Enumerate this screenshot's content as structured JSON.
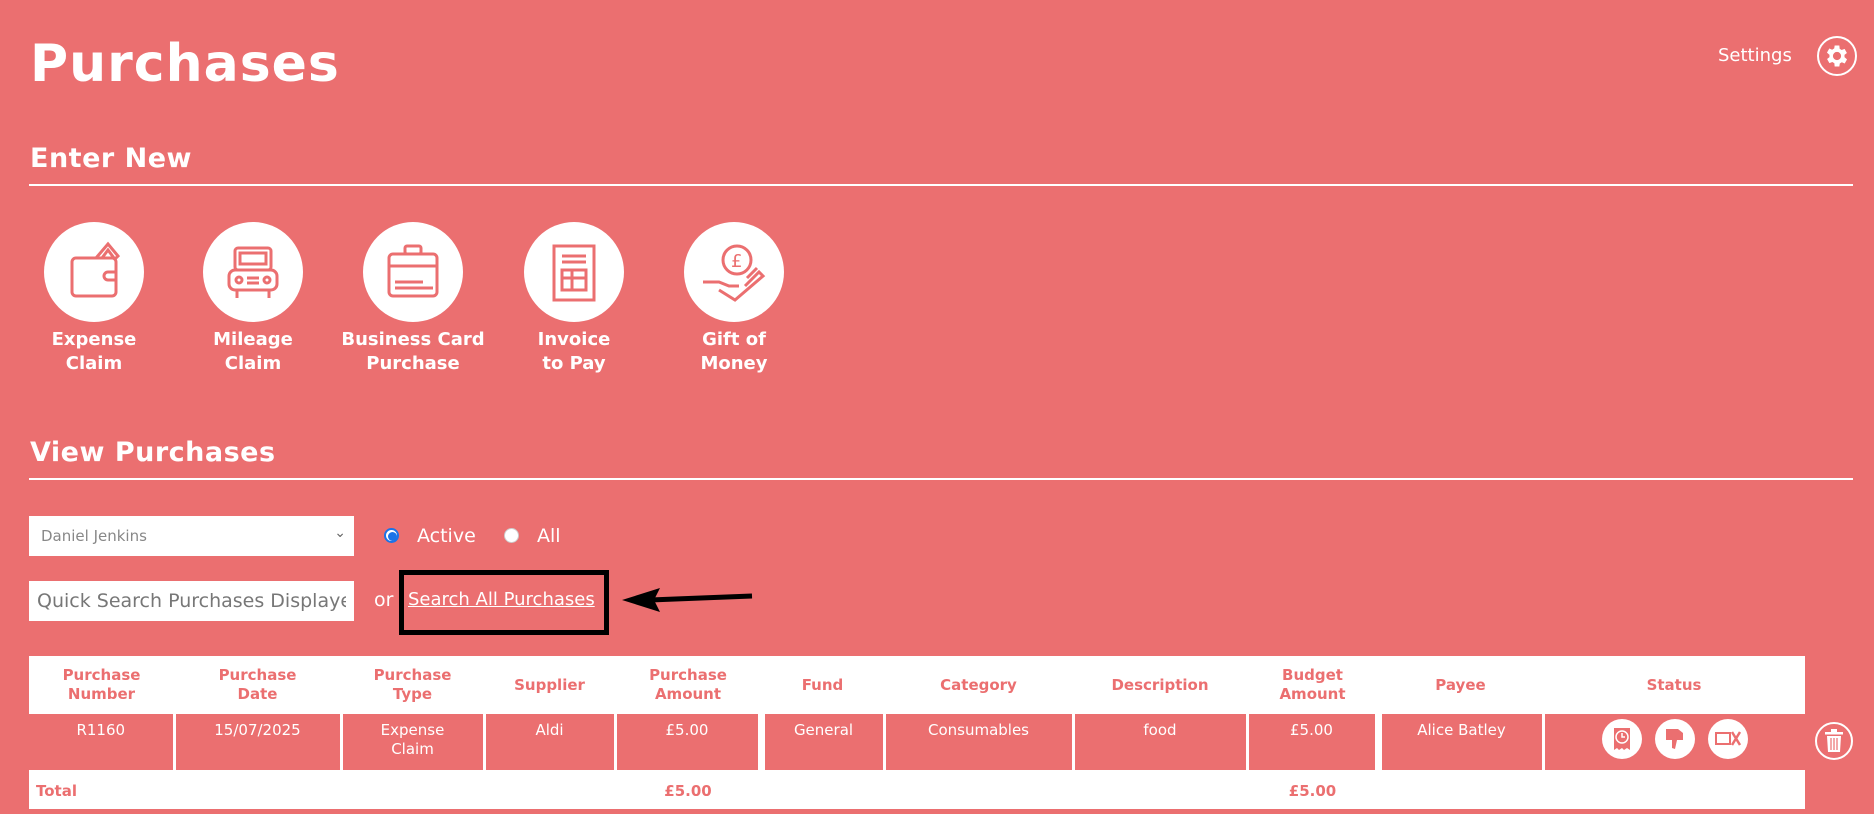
{
  "header": {
    "title": "Purchases",
    "settings_label": "Settings"
  },
  "enter_new": {
    "heading": "Enter New",
    "tiles": [
      {
        "line1": "Expense",
        "line2": "Claim",
        "icon": "wallet-icon"
      },
      {
        "line1": "Mileage",
        "line2": "Claim",
        "icon": "car-icon"
      },
      {
        "line1": "Business Card",
        "line2": "Purchase",
        "icon": "briefcase-card-icon"
      },
      {
        "line1": "Invoice",
        "line2": "to Pay",
        "icon": "invoice-icon"
      },
      {
        "line1": "Gift of",
        "line2": "Money",
        "icon": "hand-pound-icon"
      }
    ]
  },
  "view": {
    "heading": "View Purchases",
    "user_select": "Daniel Jenkins",
    "radio_active": "Active",
    "radio_all": "All",
    "search_placeholder": "Quick Search Purchases Displayed",
    "or": "or",
    "search_all": "Search All Purchases"
  },
  "table": {
    "headers": [
      [
        "Purchase",
        "Number"
      ],
      [
        "Purchase",
        "Date"
      ],
      [
        "Purchase",
        "Type"
      ],
      [
        "Supplier",
        ""
      ],
      [
        "Purchase",
        "Amount"
      ],
      [
        "Fund",
        ""
      ],
      [
        "Category",
        ""
      ],
      [
        "Description",
        ""
      ],
      [
        "Budget",
        "Amount"
      ],
      [
        "Payee",
        ""
      ],
      [
        "Status",
        ""
      ]
    ],
    "rows": [
      {
        "number": "R1160",
        "date": "15/07/2025",
        "type_1": "Expense",
        "type_2": "Claim",
        "supplier": "Aldi",
        "amount": "£5.00",
        "fund": "General",
        "category": "Consumables",
        "description": "food",
        "budget": "£5.00",
        "payee": "Alice Batley"
      }
    ],
    "total": {
      "label": "Total",
      "amount": "£5.00",
      "budget": "£5.00"
    }
  },
  "colors": {
    "background": "#EB6F70",
    "text": "#FFFFFF"
  }
}
